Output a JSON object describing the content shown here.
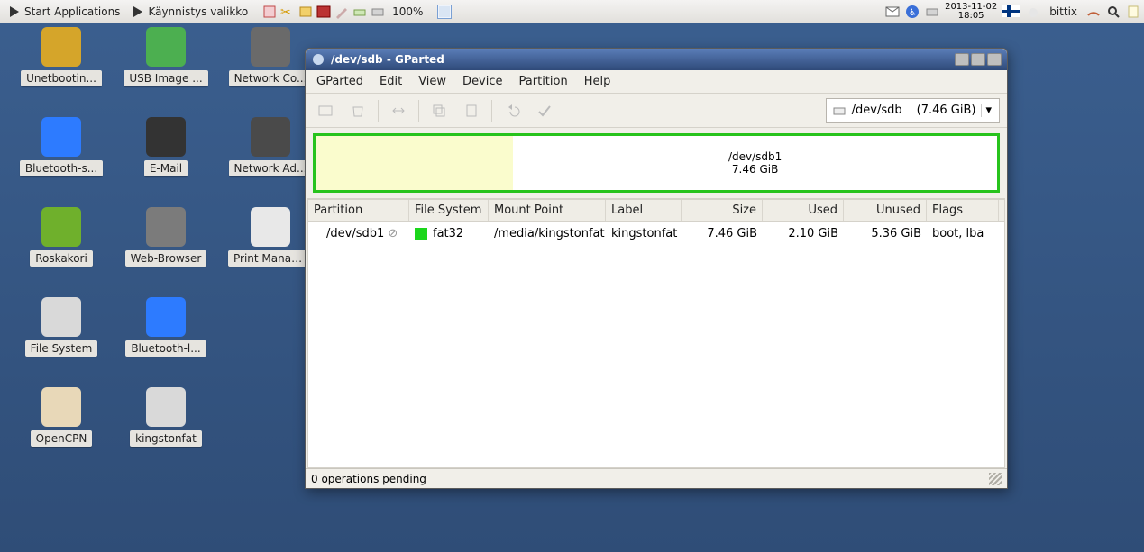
{
  "panel": {
    "start_apps": "Start Applications",
    "start_menu_fi": "Käynnistys valikko",
    "battery": "100%",
    "date": "2013-11-02",
    "time": "18:05",
    "user": "bittix"
  },
  "desktop_icons": [
    {
      "label": "Unetbootin...",
      "color": "#d5a52a"
    },
    {
      "label": "Bluetooth-s...",
      "color": "#2d7bff"
    },
    {
      "label": "Roskakori",
      "color": "#6fb02c"
    },
    {
      "label": "File System",
      "color": "#d9d9d9"
    },
    {
      "label": "OpenCPN",
      "color": "#e8d8b8"
    },
    {
      "label": "USB Image ...",
      "color": "#4caf50"
    },
    {
      "label": "E-Mail",
      "color": "#333333"
    },
    {
      "label": "Web-Browser",
      "color": "#7b7b7b"
    },
    {
      "label": "Bluetooth-l...",
      "color": "#2d7bff"
    },
    {
      "label": "kingstonfat",
      "color": "#d9d9d9"
    },
    {
      "label": "Network Co...",
      "color": "#6a6a6a"
    },
    {
      "label": "Network Ad...",
      "color": "#4a4a4a"
    },
    {
      "label": "Print Manager",
      "color": "#e8e8e8"
    }
  ],
  "window": {
    "title": "/dev/sdb - GParted",
    "menus": [
      "GParted",
      "Edit",
      "View",
      "Device",
      "Partition",
      "Help"
    ],
    "device_selector": {
      "device": "/dev/sdb",
      "size": "(7.46 GiB)"
    },
    "graph": {
      "name": "/dev/sdb1",
      "size": "7.46 GiB"
    },
    "columns": [
      "Partition",
      "File System",
      "Mount Point",
      "Label",
      "Size",
      "Used",
      "Unused",
      "Flags"
    ],
    "rows": [
      {
        "partition": "/dev/sdb1",
        "fs": "fat32",
        "mount": "/media/kingstonfat",
        "label": "kingstonfat",
        "size": "7.46 GiB",
        "used": "2.10 GiB",
        "unused": "5.36 GiB",
        "flags": "boot, lba"
      }
    ],
    "status": "0 operations pending"
  }
}
